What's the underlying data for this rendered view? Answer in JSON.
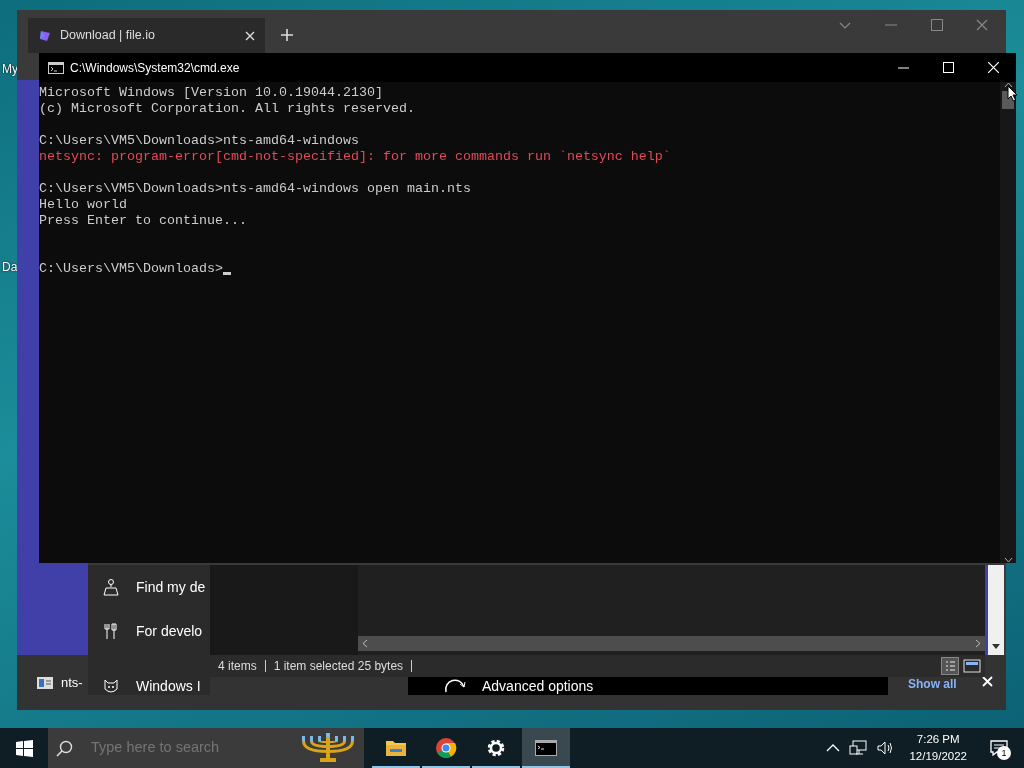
{
  "desktop": {
    "icon_labels": [
      "My",
      "Da"
    ]
  },
  "browser": {
    "tabs": [
      {
        "title": "Download | file.io",
        "selected": true
      }
    ],
    "download_bar": {
      "items": [
        {
          "name": "nts-"
        }
      ],
      "show_all": "Show all"
    }
  },
  "settings_menu": {
    "items": [
      {
        "label": "Find my de",
        "kind": "find"
      },
      {
        "label": "For develo",
        "kind": "developer"
      },
      {
        "label": "Windows I",
        "kind": "insider"
      }
    ]
  },
  "explorer": {
    "status_items": [
      "4 items",
      "1 item selected  25 bytes"
    ]
  },
  "advanced": {
    "label": "Advanced options"
  },
  "console": {
    "title": "C:\\Windows\\System32\\cmd.exe",
    "lines": [
      {
        "kind": "normal",
        "text": "Microsoft Windows [Version 10.0.19044.2130]"
      },
      {
        "kind": "normal",
        "text": "(c) Microsoft Corporation. All rights reserved."
      },
      {
        "kind": "blank"
      },
      {
        "kind": "normal",
        "text": "C:\\Users\\VM5\\Downloads>nts-amd64-windows"
      },
      {
        "kind": "error",
        "text": "netsync: program-error[cmd-not-specified]: for more commands run `netsync help`"
      },
      {
        "kind": "blank"
      },
      {
        "kind": "normal",
        "text": "C:\\Users\\VM5\\Downloads>nts-amd64-windows open main.nts"
      },
      {
        "kind": "normal",
        "text": "Hello world"
      },
      {
        "kind": "normal",
        "text": "Press Enter to continue..."
      },
      {
        "kind": "blank"
      },
      {
        "kind": "blank"
      },
      {
        "kind": "prompt",
        "text": "C:\\Users\\VM5\\Downloads>"
      }
    ]
  },
  "taskbar": {
    "search": {
      "placeholder": "Type here to search"
    },
    "apps": [
      {
        "kind": "explorer",
        "active": false
      },
      {
        "kind": "chrome",
        "active": false
      },
      {
        "kind": "settings",
        "active": false
      },
      {
        "kind": "terminal",
        "active": true
      }
    ],
    "time": "7:26 PM",
    "date": "12/19/2022",
    "notifications": "1"
  }
}
